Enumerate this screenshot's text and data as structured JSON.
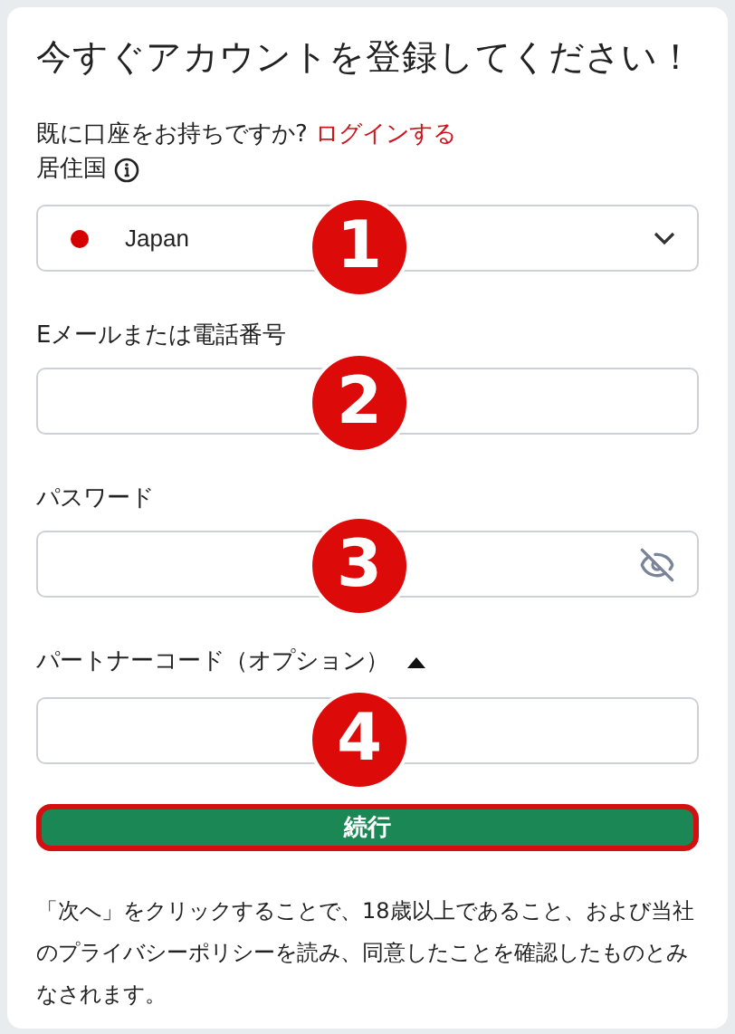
{
  "title": "今すぐアカウントを登録してください！",
  "login_prompt": {
    "text": "既に口座をお持ちですか?",
    "link": "ログインする"
  },
  "country": {
    "label": "居住国",
    "value": "Japan",
    "marker": "1"
  },
  "email": {
    "label": "Eメールまたは電話番号",
    "marker": "2"
  },
  "password": {
    "label": "パスワード",
    "marker": "3",
    "visible": false
  },
  "partner_code": {
    "label": "パートナーコード（オプション）",
    "expanded": true,
    "marker": "4"
  },
  "submit": {
    "label": "続行",
    "highlighted": true
  },
  "notice": "「次へ」をクリックすることで、18歳以上であること、および当社のプライバシーポリシーを読み、同意したことを確認したものとみなされます。"
}
